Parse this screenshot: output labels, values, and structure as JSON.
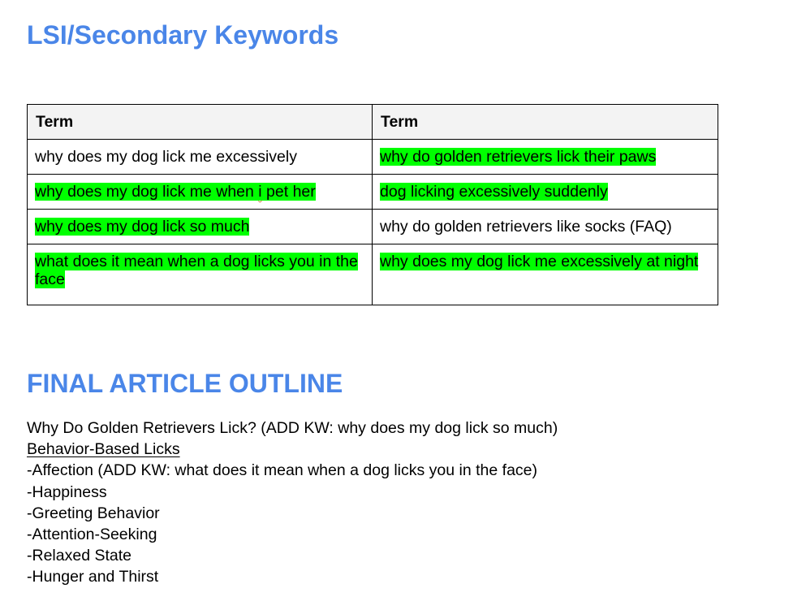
{
  "sections": {
    "lsi_heading": "LSI/Secondary Keywords",
    "outline_heading": "FINAL ARTICLE OUTLINE"
  },
  "colors": {
    "heading": "#4a86e8",
    "highlight": "#00ff00",
    "header_bg": "#f3f3f3"
  },
  "keyword_table": {
    "headers": [
      "Term",
      "Term"
    ],
    "rows": [
      [
        {
          "text": "why does my dog lick me excessively",
          "highlighted": false
        },
        {
          "text": "why do golden retrievers lick their paws",
          "highlighted": true
        }
      ],
      [
        {
          "text_before": "why does my dog lick me when ",
          "text_flagged": "i",
          "text_after": " pet her",
          "highlighted": true,
          "spellcheck_flag": "i"
        },
        {
          "text": "dog licking excessively suddenly",
          "highlighted": true
        }
      ],
      [
        {
          "text": "why does my dog lick so much",
          "highlighted": true
        },
        {
          "text": "why do golden retrievers like socks (FAQ)",
          "highlighted": false
        }
      ],
      [
        {
          "text": "what does it mean when a dog licks you in the face",
          "highlighted": true
        },
        {
          "text": "why does my dog lick me excessively at night",
          "highlighted": true
        }
      ]
    ]
  },
  "outline": {
    "title_line": "Why Do Golden Retrievers Lick? (ADD KW: why does my dog lick so much)",
    "subheading": "Behavior-Based Licks",
    "items": [
      "-Affection (ADD KW: what does it mean when a dog licks you in the face)",
      "-Happiness",
      "-Greeting Behavior",
      "-Attention-Seeking",
      "-Relaxed State",
      "-Hunger and Thirst"
    ]
  }
}
